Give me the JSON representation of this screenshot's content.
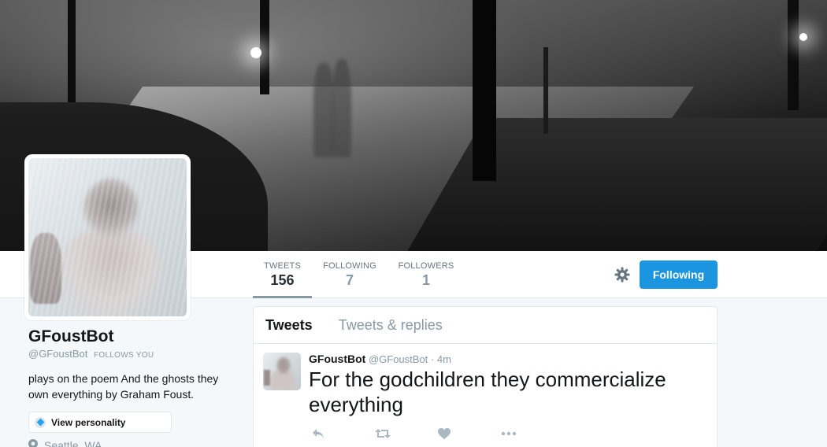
{
  "profile": {
    "name": "GFoustBot",
    "handle": "@GFoustBot",
    "follows_you": "FOLLOWS YOU",
    "bio": "plays on the poem And the ghosts they own everything by Graham Foust.",
    "personality_label": "View personality",
    "location": "Seattle, WA"
  },
  "stats": [
    {
      "label": "TWEETS",
      "value": "156",
      "active": true
    },
    {
      "label": "FOLLOWING",
      "value": "7",
      "active": false
    },
    {
      "label": "FOLLOWERS",
      "value": "1",
      "active": false
    }
  ],
  "actions": {
    "follow_button": "Following"
  },
  "timeline": {
    "tabs": [
      "Tweets",
      "Tweets & replies"
    ],
    "tweet": {
      "name": "GFoustBot",
      "handle": "@GFoustBot",
      "separator": "·",
      "time": "4m",
      "text": "For the godchildren they commercialize everything"
    }
  },
  "colors": {
    "accent": "#1b95e0",
    "muted": "#8899a6",
    "text": "#14171a"
  },
  "icons": [
    "gear-icon",
    "diamond-icon",
    "location-pin-icon",
    "reply-icon",
    "retweet-icon",
    "like-icon",
    "more-icon"
  ]
}
